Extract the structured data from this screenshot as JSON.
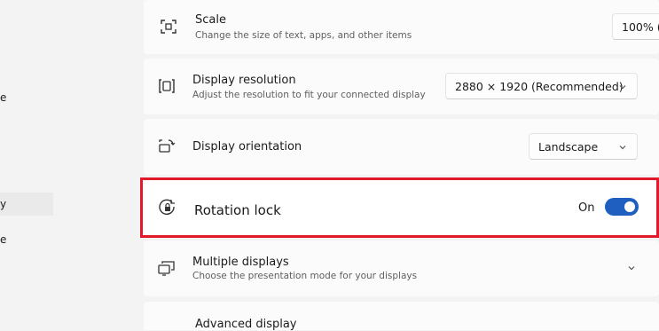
{
  "sidebar": {
    "fragments": [
      "e",
      "y",
      "e"
    ]
  },
  "scale": {
    "title": "Scale",
    "subtitle": "Change the size of text, apps, and other items",
    "value": "100% ("
  },
  "resolution": {
    "title": "Display resolution",
    "subtitle": "Adjust the resolution to fit your connected display",
    "value": "2880 × 1920 (Recommended)"
  },
  "orientation": {
    "title": "Display orientation",
    "value": "Landscape"
  },
  "rotation_lock": {
    "title": "Rotation lock",
    "state_label": "On",
    "on": true,
    "accent_color": "#1f5fbf",
    "highlight_color": "#e01a2a"
  },
  "multiple_displays": {
    "title": "Multiple displays",
    "subtitle": "Choose the presentation mode for your displays"
  },
  "advanced": {
    "title": "Advanced display"
  }
}
